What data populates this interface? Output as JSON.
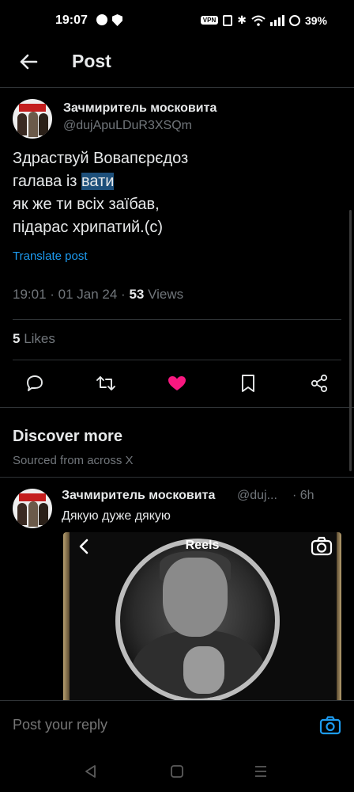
{
  "status_bar": {
    "time": "19:07",
    "vpn_label": "VPN",
    "battery": "39%"
  },
  "header": {
    "title": "Post",
    "back_icon": "arrow-left-icon"
  },
  "post": {
    "author_name": "Зачмиритель московита",
    "author_handle": "@dujApuLDuR3XSQm",
    "lines": [
      {
        "before": "Здраствуй Вовапєрєдоз",
        "highlight": "",
        "after": ""
      },
      {
        "before": "галава із ",
        "highlight": "вати",
        "after": ""
      },
      {
        "before": "як же ти всіх заїбав,",
        "highlight": "",
        "after": ""
      },
      {
        "before": "підарас хрипатий.(с)",
        "highlight": "",
        "after": ""
      }
    ],
    "translate_label": "Translate post",
    "timestamp": "19:01 · 01 Jan 24 · ",
    "views_count": "53",
    "views_label": " Views",
    "likes_count": "5",
    "likes_label": " Likes",
    "actions": [
      "reply-icon",
      "repost-icon",
      "like-icon",
      "bookmark-icon",
      "share-icon"
    ],
    "like_color": "#f91880"
  },
  "discover": {
    "title": "Discover more",
    "subtitle": "Sourced from across X"
  },
  "recommended_post": {
    "author_name": "Зачмиритель московита",
    "author_handle": "@duj...",
    "time": "· 6h",
    "text": "Дякую дуже дякую",
    "media": {
      "title": "Reels"
    }
  },
  "reply": {
    "placeholder": "Post your reply",
    "camera_icon": "camera-icon",
    "accent": "#1d9bf0"
  },
  "nav": [
    "back-nav-icon",
    "home-nav-icon",
    "recents-nav-icon"
  ]
}
